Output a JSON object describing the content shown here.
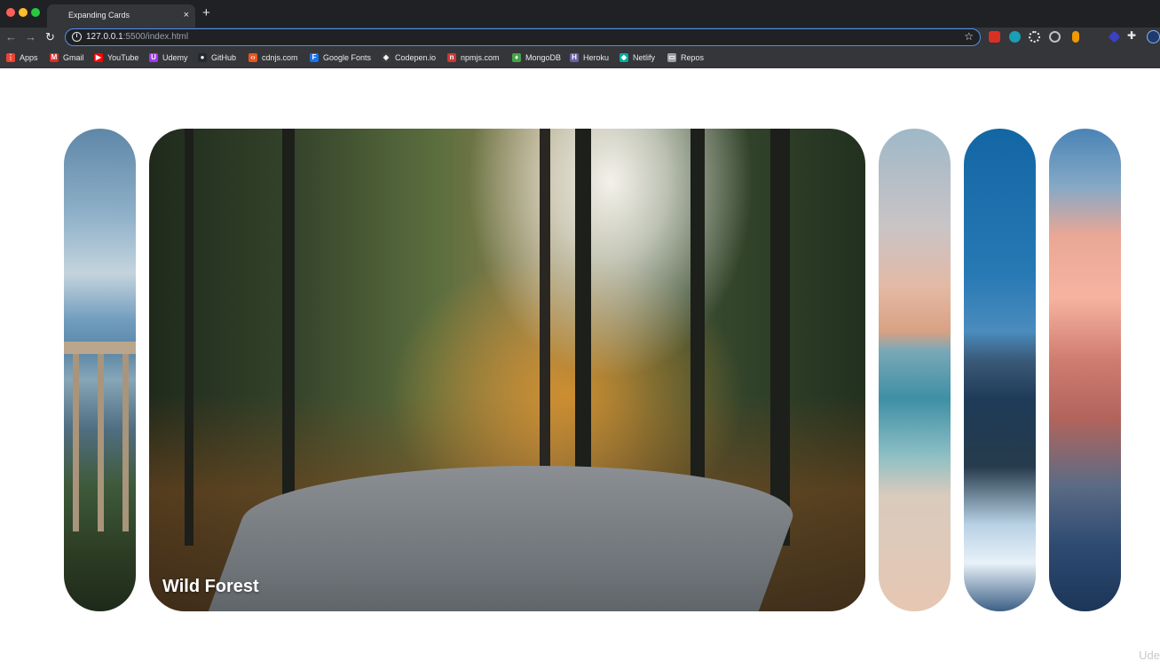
{
  "browser": {
    "tab_title": "Expanding Cards",
    "close_glyph": "×",
    "new_tab_glyph": "+",
    "url_host": "127.0.0.1",
    "url_path": ":5500/index.html",
    "info_glyph": "i",
    "star_glyph": "☆",
    "back_glyph": "←",
    "forward_glyph": "→",
    "reload_glyph": "↻",
    "extensions_glyph": "✚"
  },
  "bookmarks": [
    {
      "label": "Apps",
      "icon": "apps-grid-icon",
      "color": "#ea4335",
      "glyph": "⋮"
    },
    {
      "label": "Gmail",
      "icon": "gmail-icon",
      "color": "#d93025",
      "glyph": "M"
    },
    {
      "label": "YouTube",
      "icon": "youtube-icon",
      "color": "#ff0000",
      "glyph": "▶"
    },
    {
      "label": "Udemy",
      "icon": "udemy-icon",
      "color": "#a435f0",
      "glyph": "U"
    },
    {
      "label": "GitHub",
      "icon": "github-icon",
      "color": "#24292e",
      "glyph": "●"
    },
    {
      "label": "cdnjs.com",
      "icon": "cdnjs-icon",
      "color": "#e95420",
      "glyph": "‹›"
    },
    {
      "label": "Google Fonts",
      "icon": "google-fonts-icon",
      "color": "#1a73e8",
      "glyph": "F"
    },
    {
      "label": "Codepen.io",
      "icon": "codepen-icon",
      "color": "#3c3c3c",
      "glyph": "◈"
    },
    {
      "label": "npmjs.com",
      "icon": "npm-icon",
      "color": "#cb3837",
      "glyph": "n"
    },
    {
      "label": "MongoDB",
      "icon": "mongodb-icon",
      "color": "#47a248",
      "glyph": "♦"
    },
    {
      "label": "Heroku",
      "icon": "heroku-icon",
      "color": "#6762a6",
      "glyph": "H"
    },
    {
      "label": "Netlify",
      "icon": "netlify-icon",
      "color": "#00ad9f",
      "glyph": "◆"
    },
    {
      "label": "Repos",
      "icon": "folder-icon",
      "color": "#9aa0a6",
      "glyph": "▭"
    }
  ],
  "panels": [
    {
      "title": "",
      "active": false
    },
    {
      "title": "Wild Forest",
      "active": true
    },
    {
      "title": "",
      "active": false
    },
    {
      "title": "",
      "active": false
    },
    {
      "title": "",
      "active": false
    }
  ],
  "watermark": "Ude"
}
